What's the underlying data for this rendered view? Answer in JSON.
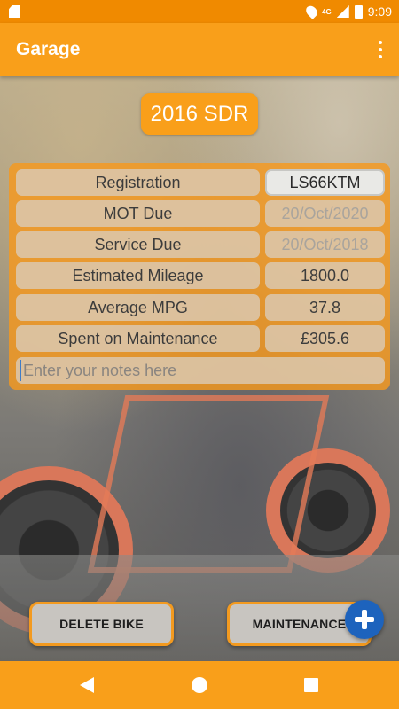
{
  "status_bar": {
    "time": "9:09",
    "network": "4G"
  },
  "app_bar": {
    "title": "Garage"
  },
  "bike": {
    "name": "2016 SDR"
  },
  "details": [
    {
      "label": "Registration",
      "value": "LS66KTM"
    },
    {
      "label": "MOT Due",
      "value": "20/Oct/2020"
    },
    {
      "label": "Service Due",
      "value": "20/Oct/2018"
    },
    {
      "label": "Estimated Mileage",
      "value": "1800.0"
    },
    {
      "label": "Average MPG",
      "value": "37.8"
    },
    {
      "label": "Spent on Maintenance",
      "value": "£305.6"
    }
  ],
  "notes": {
    "placeholder": "Enter your notes here"
  },
  "buttons": {
    "delete": "DELETE BIKE",
    "maintenance": "MAINTENANCE"
  },
  "colors": {
    "accent": "#f99f1a",
    "fab": "#1d63bd"
  }
}
